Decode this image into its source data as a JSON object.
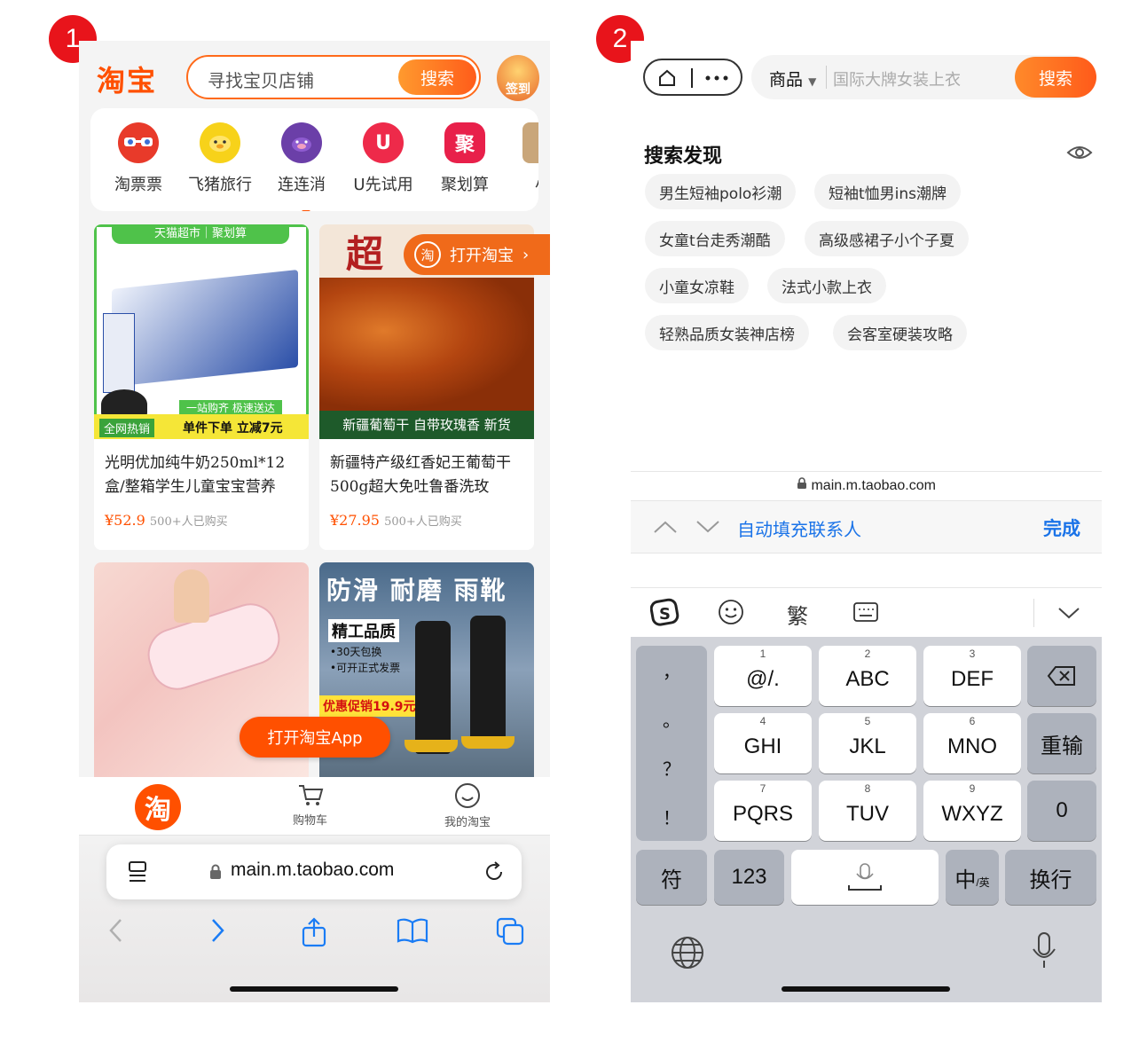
{
  "badges": [
    "1",
    "2"
  ],
  "phone1": {
    "logo": "淘宝",
    "search": {
      "placeholder": "寻找宝贝店铺",
      "button": "搜索"
    },
    "signin_label": "签到",
    "nav": [
      {
        "label": "淘票票",
        "icon": "movie-glasses-icon",
        "color": "#e83a2a",
        "glyph": ""
      },
      {
        "label": "飞猪旅行",
        "icon": "flying-pig-icon",
        "color": "#f7d21a",
        "glyph": ""
      },
      {
        "label": "连连消",
        "icon": "purple-pig-icon",
        "color": "#6b3fa8",
        "glyph": ""
      },
      {
        "label": "U先试用",
        "icon": "u-trial-icon",
        "color": "#ee2a4a",
        "glyph": "U"
      },
      {
        "label": "聚划算",
        "icon": "juhuasuan-icon",
        "color": "#e8204a",
        "glyph": "聚"
      },
      {
        "label": "小",
        "icon": "more-icon",
        "color": "#c9a67a",
        "glyph": ""
      }
    ],
    "products": [
      {
        "banner": "天猫超市｜聚划算",
        "tagline": "一站购齐 极速送达",
        "hot": "全网热销",
        "promo": "单件下单 立减7元",
        "title": "光明优加纯牛奶250ml*12盒/整箱学生儿童宝宝营养",
        "price": "¥52.9",
        "sold": "500+人已购买"
      },
      {
        "overlay": "打开淘宝",
        "headline": "超",
        "strip": "新疆葡萄干 自带玫瑰香 新货",
        "title": "新疆特产级红香妃王葡萄干500g超大免吐鲁番洗玫",
        "price": "¥27.95",
        "sold": "500+人已购买"
      },
      {
        "title": "",
        "price": "",
        "sold": ""
      },
      {
        "headline": "防滑 耐磨 雨靴",
        "sub": "精工品质",
        "bullets": [
          "•30天包换",
          "•可开正式发票"
        ],
        "promo": "优惠促销19.9元起"
      }
    ],
    "open_app": "打开淘宝App",
    "tabs": {
      "home": "淘",
      "cart": "购物车",
      "mine": "我的淘宝"
    },
    "url": "main.m.taobao.com"
  },
  "phone2": {
    "search": {
      "category": "商品",
      "placeholder": "国际大牌女装上衣",
      "button": "搜索"
    },
    "discover_title": "搜索发现",
    "chips": [
      "男生短袖polo衫潮",
      "短袖t恤男ins潮牌",
      "女童t台走秀潮酷",
      "高级感裙子小个子夏",
      "小童女凉鞋",
      "法式小款上衣",
      "轻熟品质女装神店榜",
      "会客室硬装攻略"
    ],
    "domain": "main.m.taobao.com",
    "autofill": {
      "text": "自动填充联系人",
      "done": "完成"
    },
    "kb_toolbar": {
      "trad": "繁"
    },
    "punct": [
      "，",
      "。",
      "？",
      "！"
    ],
    "keys": [
      {
        "num": "1",
        "label": "@/."
      },
      {
        "num": "2",
        "label": "ABC"
      },
      {
        "num": "3",
        "label": "DEF"
      },
      {
        "num": "4",
        "label": "GHI"
      },
      {
        "num": "5",
        "label": "JKL"
      },
      {
        "num": "6",
        "label": "MNO"
      },
      {
        "num": "7",
        "label": "PQRS"
      },
      {
        "num": "8",
        "label": "TUV"
      },
      {
        "num": "9",
        "label": "WXYZ"
      }
    ],
    "special": {
      "reenter": "重输",
      "zero": "0",
      "symbol": "符",
      "num": "123",
      "cn": "中",
      "en": "/英",
      "newline": "换行"
    }
  }
}
